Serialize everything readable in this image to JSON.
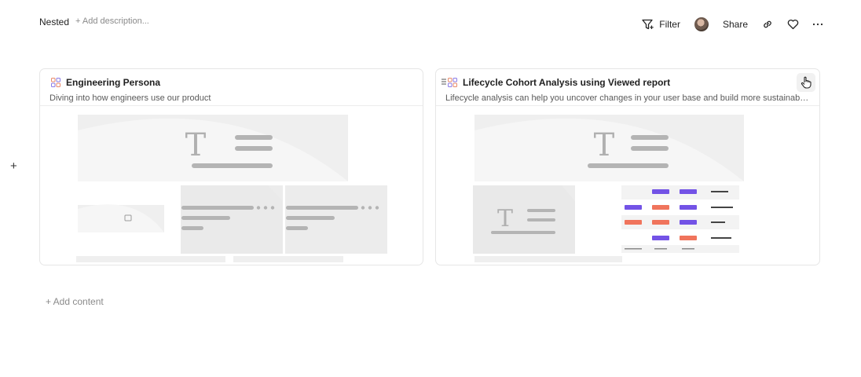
{
  "header": {
    "title": "Nested",
    "add_description": "+ Add description...",
    "filter_label": "Filter",
    "share_label": "Share"
  },
  "cards": [
    {
      "title": "Engineering Persona",
      "description": "Diving into how engineers use our product"
    },
    {
      "title": "Lifecycle Cohort Analysis using Viewed report",
      "description": "Lifecycle analysis can help you uncover changes in your user base and build more sustainable usage"
    }
  ],
  "add_content_label": "+ Add content",
  "side_add_label": "+",
  "icons": {
    "filter": "filter-icon",
    "link": "link-icon",
    "favorite": "heart-icon",
    "more": "more-horizontal-icon",
    "card_type": "board-grid-icon",
    "drag": "drag-handle-icon"
  },
  "colors": {
    "placeholder_bg": "#ececec",
    "placeholder_bar": "#b4b4b4",
    "purple_tag": "#7353e6",
    "orange_tag": "#f0745c"
  }
}
